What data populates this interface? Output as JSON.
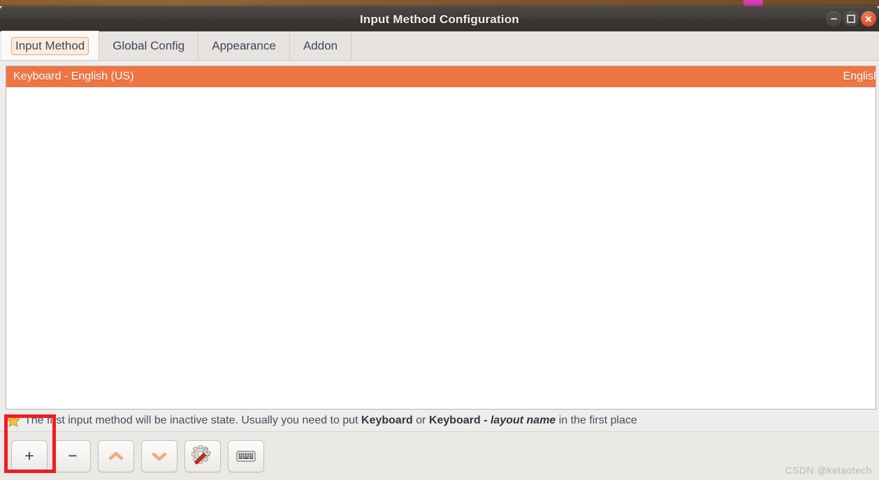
{
  "window": {
    "title": "Input Method Configuration",
    "controls": {
      "minimize": "minimize",
      "maximize": "maximize",
      "close": "✕"
    }
  },
  "tabs": [
    {
      "label": "Input Method",
      "active": true
    },
    {
      "label": "Global Config",
      "active": false
    },
    {
      "label": "Appearance",
      "active": false
    },
    {
      "label": "Addon",
      "active": false
    }
  ],
  "list": {
    "rows": [
      {
        "name": "Keyboard - English (US)",
        "language": "English",
        "selected": true
      }
    ]
  },
  "hint": {
    "icon": "star-icon",
    "text_part1": "The first input method will be inactive state. Usually you need to put ",
    "bold1": "Keyboard",
    "text_part2": " or ",
    "bold2": "Keyboard - ",
    "italic1": "layout name",
    "text_part3": " in the first place"
  },
  "toolbar": {
    "buttons": [
      {
        "name": "add-input-method-button",
        "glyph": "+",
        "icon": "plus-icon",
        "enabled": true
      },
      {
        "name": "remove-input-method-button",
        "glyph": "−",
        "icon": "minus-icon",
        "enabled": true
      },
      {
        "name": "move-up-button",
        "glyph": "",
        "icon": "chevron-up-icon",
        "enabled": false
      },
      {
        "name": "move-down-button",
        "glyph": "",
        "icon": "chevron-down-icon",
        "enabled": false
      },
      {
        "name": "configure-button",
        "glyph": "",
        "icon": "gear-wrench-icon",
        "enabled": true
      },
      {
        "name": "keyboard-layout-button",
        "glyph": "",
        "icon": "keyboard-icon",
        "enabled": true
      }
    ]
  },
  "annotation": {
    "color": "#ee1d23",
    "target": "add-input-method-button"
  },
  "watermark": {
    "text": "CSDN @ketaotech"
  }
}
